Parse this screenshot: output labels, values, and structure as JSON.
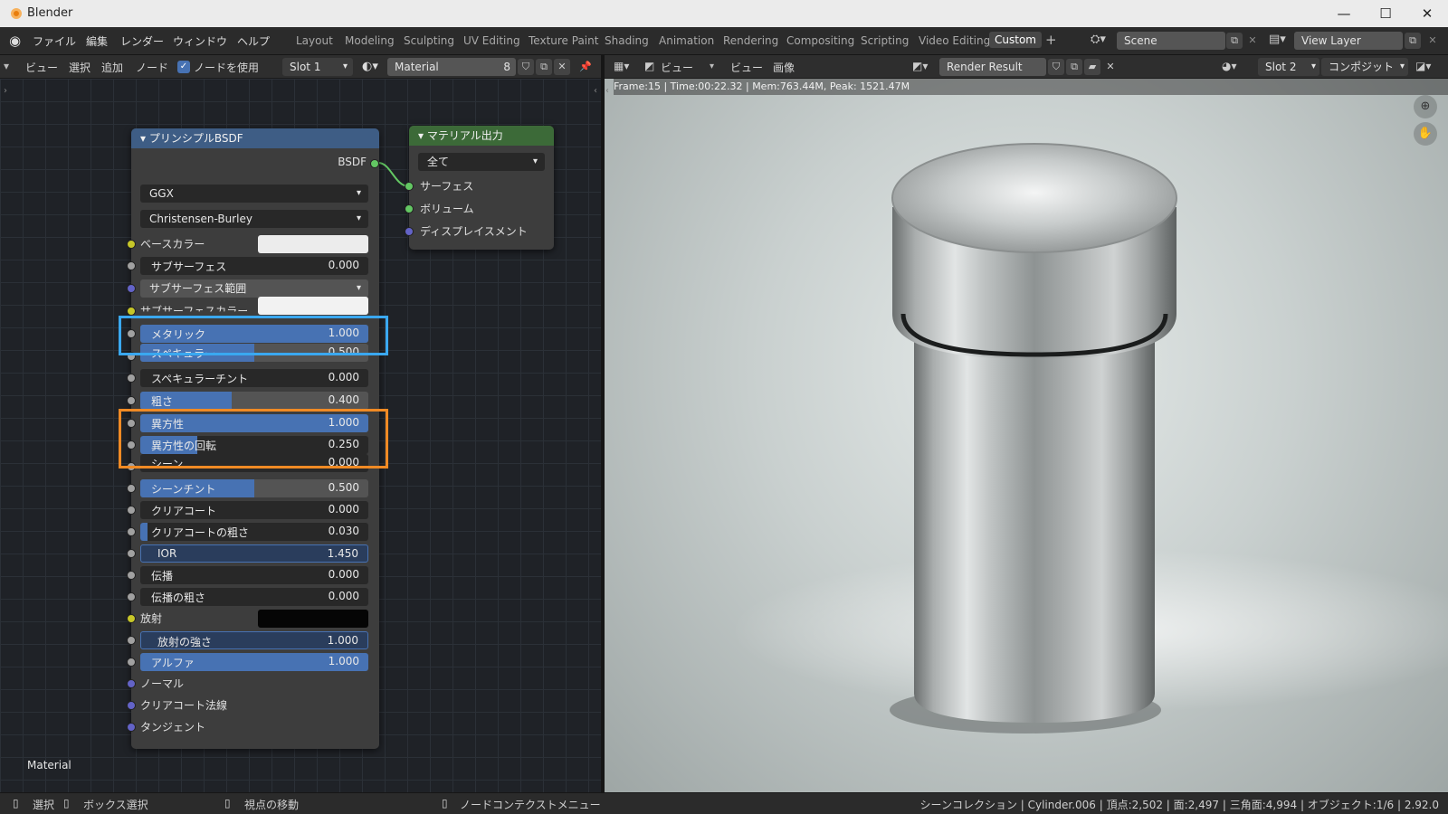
{
  "window": {
    "title": "Blender",
    "minimize": "—",
    "maximize": "☐",
    "close": "✕"
  },
  "menu": {
    "items": [
      "ファイル",
      "編集",
      "レンダー",
      "ウィンドウ",
      "ヘルプ"
    ]
  },
  "workspaces": [
    "Layout",
    "Modeling",
    "Sculpting",
    "UV Editing",
    "Texture Paint",
    "Shading",
    "Animation",
    "Rendering",
    "Compositing",
    "Scripting",
    "Video Editing",
    "Custom"
  ],
  "active_workspace": "Custom",
  "add_workspace": "+",
  "scene": {
    "value": "Scene"
  },
  "view_layer": {
    "value": "View Layer"
  },
  "node_header": {
    "items": [
      "ビュー",
      "選択",
      "追加",
      "ノード"
    ],
    "use_nodes_label": "ノードを使用",
    "slot": "Slot 1",
    "material": "Material",
    "users": "8"
  },
  "image_header": {
    "view_dropdown": "ビュー",
    "items": [
      "ビュー",
      "画像"
    ],
    "image_name": "Render Result",
    "slot": "Slot 2",
    "pass": "コンポジット"
  },
  "render_info": "Frame:15 | Time:00:22.32 | Mem:763.44M, Peak: 1521.47M",
  "principled": {
    "title": "プリンシプルBSDF",
    "output_label": "BSDF",
    "distribution": "GGX",
    "subsurface_method": "Christensen-Burley",
    "base_color_label": "ベースカラー",
    "subsurface": {
      "label": "サブサーフェス",
      "value": "0.000"
    },
    "subsurface_radius": "サブサーフェス範囲",
    "subsurface_color_label": "サブサーフェスカラー",
    "metallic": {
      "label": "メタリック",
      "value": "1.000",
      "fill": 1.0
    },
    "specular": {
      "label": "スペキュラー",
      "value": "0.500",
      "fill": 0.5
    },
    "specular_tint": {
      "label": "スペキュラーチント",
      "value": "0.000",
      "fill": 0.0
    },
    "roughness": {
      "label": "粗さ",
      "value": "0.400",
      "fill": 0.4
    },
    "anisotropic": {
      "label": "異方性",
      "value": "1.000",
      "fill": 1.0
    },
    "anisotropic_rotation": {
      "label": "異方性の回転",
      "value": "0.250",
      "fill": 0.25
    },
    "sheen": {
      "label": "シーン",
      "value": "0.000",
      "fill": 0.0
    },
    "sheen_tint": {
      "label": "シーンチント",
      "value": "0.500",
      "fill": 0.5
    },
    "clearcoat": {
      "label": "クリアコート",
      "value": "0.000",
      "fill": 0.0
    },
    "clearcoat_roughness": {
      "label": "クリアコートの粗さ",
      "value": "0.030",
      "fill": 0.03
    },
    "ior": {
      "label": "IOR",
      "value": "1.450"
    },
    "transmission": {
      "label": "伝播",
      "value": "0.000"
    },
    "transmission_roughness": {
      "label": "伝播の粗さ",
      "value": "0.000"
    },
    "emission_label": "放射",
    "emission_strength": {
      "label": "放射の強さ",
      "value": "1.000"
    },
    "alpha": {
      "label": "アルファ",
      "value": "1.000"
    },
    "normal_label": "ノーマル",
    "clearcoat_normal_label": "クリアコート法線",
    "tangent_label": "タンジェント"
  },
  "output_node": {
    "title": "マテリアル出力",
    "target": "全て",
    "surface": "サーフェス",
    "volume": "ボリューム",
    "displacement": "ディスプレイスメント"
  },
  "editor_label": "Material",
  "status": {
    "select": "選択",
    "box_select": "ボックス選択",
    "pan_view": "視点の移動",
    "context_menu": "ノードコンテクストメニュー",
    "stats": "シーンコレクション | Cylinder.006 | 頂点:2,502 | 面:2,497 | 三角面:4,994 | オブジェクト:1/6 | 2.92.0"
  },
  "colors": {
    "accent": "#4772b3",
    "highlight_blue": "#3aa8f0",
    "highlight_orange": "#f08a24",
    "node_header_shader": "#3e5d85",
    "node_header_output": "#3c6a38"
  }
}
